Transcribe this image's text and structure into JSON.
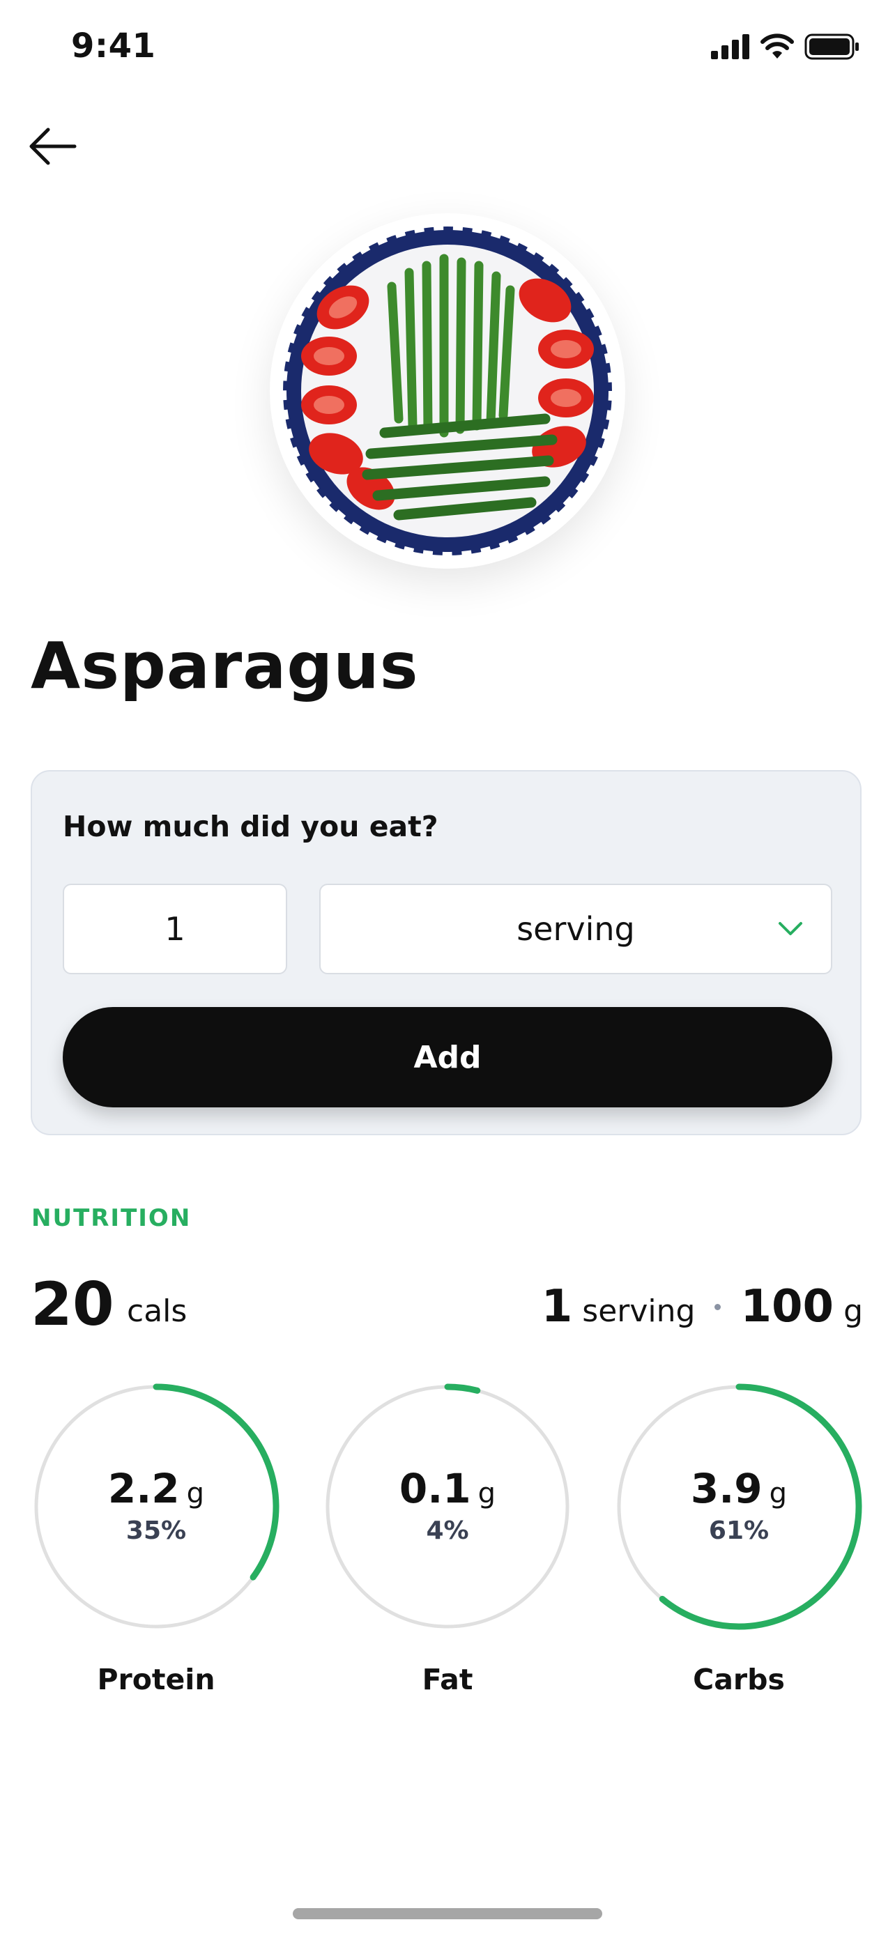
{
  "status_bar": {
    "time": "9:41"
  },
  "food": {
    "name": "Asparagus"
  },
  "portion": {
    "question": "How much did you eat?",
    "quantity": "1",
    "unit": "serving",
    "add_label": "Add"
  },
  "nutrition": {
    "section_label": "NUTRITION",
    "calories": "20",
    "calories_unit": "cals",
    "serving_count": "1",
    "serving_unit": "serving",
    "weight": "100",
    "weight_unit": "g",
    "macros": [
      {
        "label": "Protein",
        "value": "2.2",
        "unit": "g",
        "percent": "35%",
        "fraction": 0.35
      },
      {
        "label": "Fat",
        "value": "0.1",
        "unit": "g",
        "percent": "4%",
        "fraction": 0.04
      },
      {
        "label": "Carbs",
        "value": "3.9",
        "unit": "g",
        "percent": "61%",
        "fraction": 0.61
      }
    ]
  },
  "colors": {
    "accent": "#27ae60",
    "button": "#0e0e0e",
    "ring_track": "#e0e0e0"
  }
}
